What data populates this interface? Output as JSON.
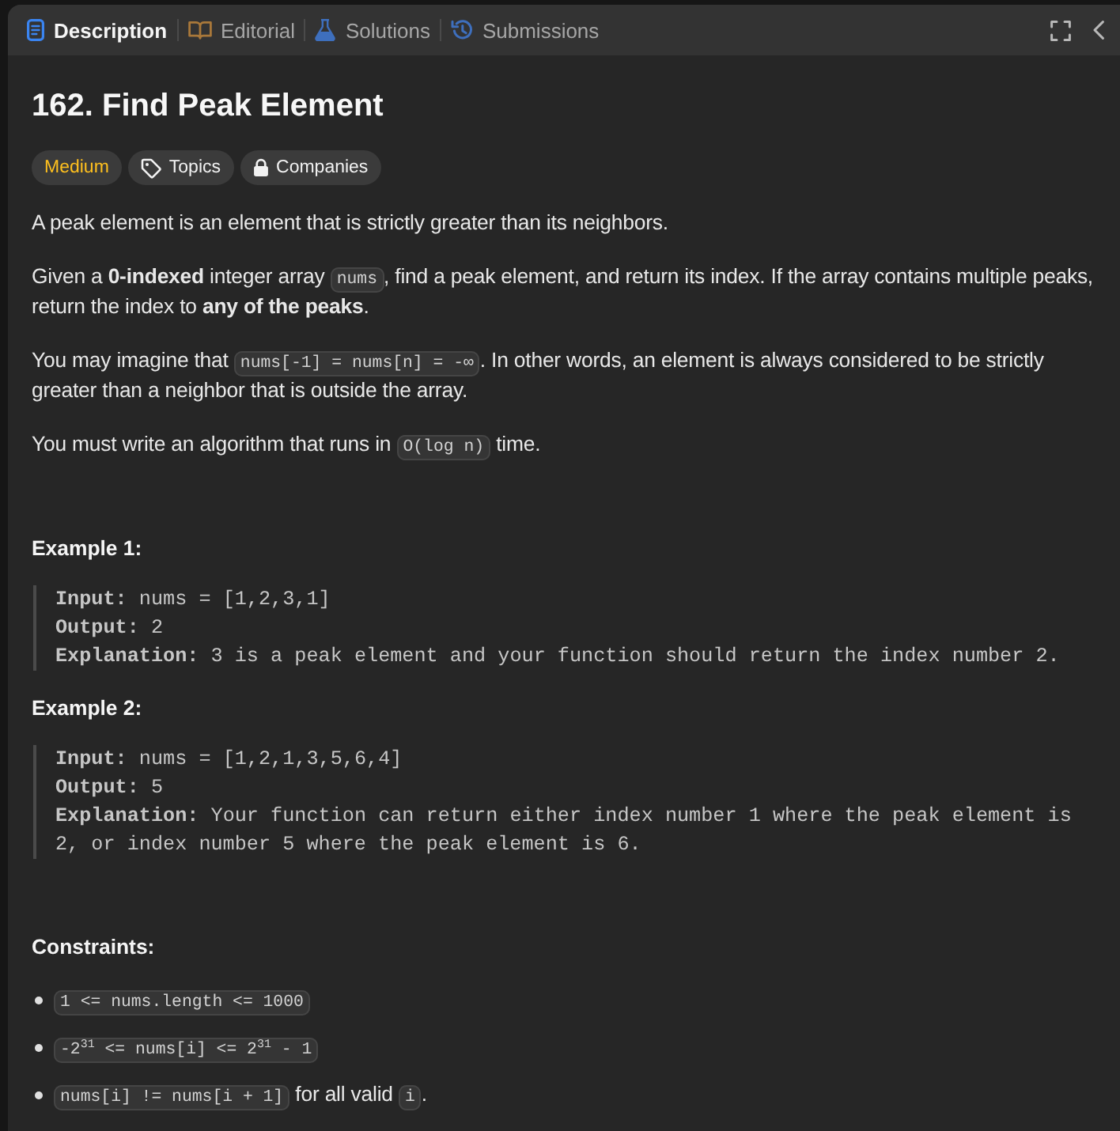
{
  "tabs": [
    {
      "label": "Description",
      "selected": true
    },
    {
      "label": "Editorial",
      "selected": false
    },
    {
      "label": "Solutions",
      "selected": false
    },
    {
      "label": "Submissions",
      "selected": false
    }
  ],
  "title": "162. Find Peak Element",
  "tags": [
    {
      "kind": "difficulty",
      "label": "Medium"
    },
    {
      "kind": "topics",
      "label": "Topics"
    },
    {
      "kind": "companies",
      "label": "Companies"
    }
  ],
  "description": [
    {
      "parts": [
        {
          "kind": "text",
          "text": "A peak element is an element that is strictly greater than its neighbors."
        }
      ]
    },
    {
      "parts": [
        {
          "kind": "text",
          "text": "Given a **0-indexed** integer array "
        },
        {
          "kind": "code",
          "text": "nums"
        },
        {
          "kind": "text",
          "text": ", find a peak element, and return its index. If the array contains multiple peaks, return the index to **any of the peaks**."
        }
      ]
    },
    {
      "parts": [
        {
          "kind": "text",
          "text": "You may imagine that "
        },
        {
          "kind": "code",
          "text": "nums[-1] = nums[n] = -∞"
        },
        {
          "kind": "text",
          "text": ". In other words, an element is always considered to be strictly greater than a neighbor that is outside the array."
        }
      ]
    },
    {
      "parts": [
        {
          "kind": "text",
          "text": "You must write an algorithm that runs in "
        },
        {
          "kind": "code",
          "text": "O(log n)"
        },
        {
          "kind": "text",
          "text": " time."
        }
      ]
    }
  ],
  "examples": [
    {
      "heading": "Example 1:",
      "lines": [
        "**Input:** nums = [1,2,3,1]",
        "**Output:** 2",
        "**Explanation:** 3 is a peak element and your function should return the index number 2."
      ]
    },
    {
      "heading": "Example 2:",
      "lines": [
        "**Input:** nums = [1,2,1,3,5,6,4]",
        "**Output:** 5",
        "**Explanation:** Your function can return either index number 1 where the peak element is 2, or index number 5 where the peak element is 6."
      ]
    }
  ],
  "constraints": {
    "heading": "Constraints:",
    "items": [
      {
        "parts": [
          {
            "kind": "code",
            "text": "1 <= nums.length <= 1000"
          }
        ]
      },
      {
        "parts": [
          {
            "kind": "code",
            "text": "-2$^{31}$ <= nums[i] <= 2$^{31}$ - 1"
          }
        ]
      },
      {
        "parts": [
          {
            "kind": "code",
            "text": "nums[i] != nums[i + 1]"
          },
          {
            "kind": "text",
            "text": " for all valid "
          },
          {
            "kind": "code",
            "text": "i"
          },
          {
            "kind": "text",
            "text": "."
          }
        ]
      }
    ]
  }
}
